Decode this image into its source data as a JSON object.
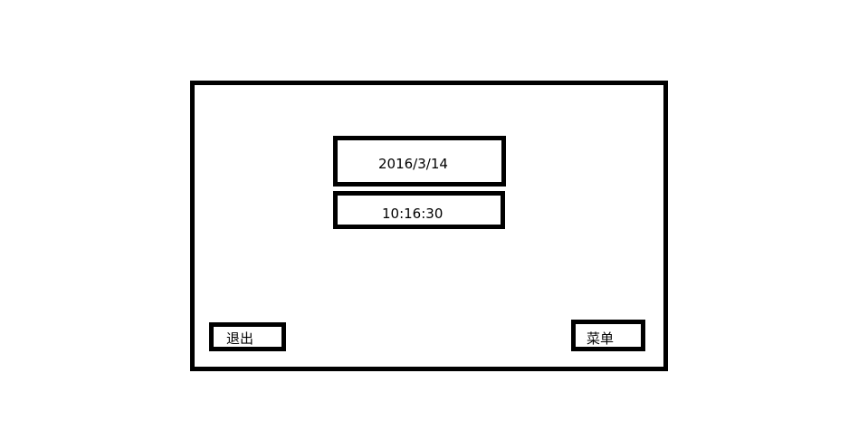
{
  "display": {
    "date": "2016/3/14",
    "time": "10:16:30"
  },
  "buttons": {
    "exit_label": "退出",
    "menu_label": "菜单"
  }
}
